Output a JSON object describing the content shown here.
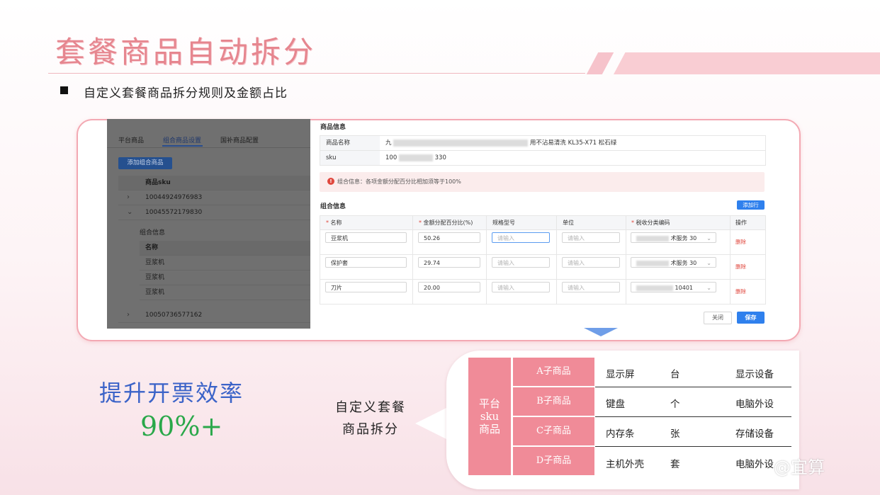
{
  "slide": {
    "title": "套餐商品自动拆分",
    "bullet": "自定义套餐商品拆分规则及金额占比"
  },
  "left_panel": {
    "tabs": [
      "平台商品",
      "组合商品设置",
      "国补商品配置"
    ],
    "active_tab": 1,
    "add_button": "添加组合商品",
    "column_header": "商品sku",
    "rows": [
      {
        "chevron": "›",
        "sku": "10044924976983"
      },
      {
        "chevron": "⌄",
        "sku": "10045572179830"
      }
    ],
    "group_title": "组合信息",
    "group_header": "名称",
    "group_items": [
      "豆浆机",
      "豆浆机",
      "豆浆机"
    ],
    "last_row": {
      "chevron": "›",
      "sku": "10050736577162"
    }
  },
  "product_info": {
    "heading": "商品信息",
    "name_label": "商品名称",
    "name_prefix": "九",
    "name_suffix": "用不沾易清洗 KL35-X71 松石绿",
    "sku_label": "sku",
    "sku_prefix": "100",
    "sku_suffix": "330"
  },
  "alert": {
    "icon": "!",
    "text": "组合信息：各项金额分配百分比相加须等于100%"
  },
  "combo": {
    "heading": "组合信息",
    "add_row_button": "添加行",
    "columns": [
      "名称",
      "金额分配百分比(%)",
      "规格型号",
      "单位",
      "税收分类编码",
      "操作"
    ],
    "required": [
      true,
      true,
      false,
      false,
      true,
      false
    ],
    "placeholder": "请输入",
    "delete_label": "删除",
    "rows": [
      {
        "name": "豆浆机",
        "percent": "50.26",
        "tax": "术服务 30"
      },
      {
        "name": "保护套",
        "percent": "29.74",
        "tax": "术服务 30"
      },
      {
        "name": "刀片",
        "percent": "20.00",
        "tax": "10401"
      }
    ],
    "close_button": "关闭",
    "save_button": "保存"
  },
  "efficiency": {
    "label": "提升开票效率",
    "value": "90%+"
  },
  "custom_split": {
    "line1": "自定义套餐",
    "line2": "商品拆分"
  },
  "split_diagram": {
    "platform_label": "平台sku商品",
    "children": [
      {
        "label": "A子商品",
        "name": "显示屏",
        "unit": "台",
        "category": "显示设备"
      },
      {
        "label": "B子商品",
        "name": "键盘",
        "unit": "个",
        "category": "电脑外设"
      },
      {
        "label": "C子商品",
        "name": "内存条",
        "unit": "张",
        "category": "存储设备"
      },
      {
        "label": "D子商品",
        "name": "主机外壳",
        "unit": "套",
        "category": "电脑外设"
      }
    ]
  },
  "watermark": "@宜算",
  "colors": {
    "title": "#e6868f",
    "accent_pink": "#f08b98",
    "efficiency_blue": "#3b63c8",
    "efficiency_green": "#2aa84a",
    "primary_button": "#2f80ed"
  }
}
